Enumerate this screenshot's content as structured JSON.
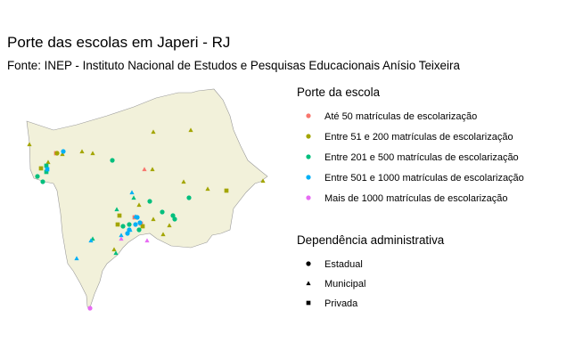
{
  "title": "Porte das escolas em Japeri - RJ",
  "subtitle": "Fonte: INEP - Instituto Nacional de Estudos e Pesquisas Educacionais Anísio Teixeira",
  "colors": {
    "map_fill": "#f2f1da",
    "map_stroke": "#9a9a9a"
  },
  "legend_size": {
    "title": "Porte da escola",
    "items": [
      {
        "key": "ate50",
        "label": "Até 50 matrículas de escolarização",
        "color": "#f8766d"
      },
      {
        "key": "s51_200",
        "label": "Entre 51 e 200 matrículas de escolarização",
        "color": "#a3a500"
      },
      {
        "key": "s201_500",
        "label": "Entre 201 e 500 matrículas de escolarização",
        "color": "#00bf7d"
      },
      {
        "key": "s501_1000",
        "label": "Entre 501 e 1000 matrículas de escolarização",
        "color": "#00b0f6"
      },
      {
        "key": "mais1000",
        "label": "Mais de 1000 matrículas de escolarização",
        "color": "#e76bf3"
      }
    ]
  },
  "legend_type": {
    "title": "Dependência administrativa",
    "items": [
      {
        "key": "estadual",
        "label": "Estadual",
        "shape": "circle"
      },
      {
        "key": "municipal",
        "label": "Municipal",
        "shape": "triangle"
      },
      {
        "key": "privada",
        "label": "Privada",
        "shape": "square"
      }
    ]
  },
  "schools": [
    {
      "porte": "ate50",
      "dep": "privada"
    },
    {
      "porte": "ate50",
      "dep": "municipal"
    },
    {
      "porte": "ate50",
      "dep": "privada"
    },
    {
      "porte": "ate50",
      "dep": "privada"
    },
    {
      "porte": "s51_200",
      "dep": "municipal"
    },
    {
      "porte": "s51_200",
      "dep": "municipal"
    },
    {
      "porte": "s51_200",
      "dep": "municipal"
    },
    {
      "porte": "s51_200",
      "dep": "municipal"
    },
    {
      "porte": "s51_200",
      "dep": "circle"
    },
    {
      "porte": "s51_200",
      "dep": "municipal"
    },
    {
      "porte": "s51_200",
      "dep": "municipal"
    },
    {
      "porte": "s51_200",
      "dep": "municipal"
    },
    {
      "porte": "s51_200",
      "dep": "municipal"
    },
    {
      "porte": "s51_200",
      "dep": "municipal"
    },
    {
      "porte": "s51_200",
      "dep": "municipal"
    },
    {
      "porte": "s51_200",
      "dep": "privada"
    },
    {
      "porte": "s51_200",
      "dep": "municipal"
    },
    {
      "porte": "s51_200",
      "dep": "privada"
    },
    {
      "porte": "s51_200",
      "dep": "municipal"
    },
    {
      "porte": "s51_200",
      "dep": "municipal"
    },
    {
      "porte": "s51_200",
      "dep": "municipal"
    },
    {
      "porte": "s51_200",
      "dep": "privada"
    },
    {
      "porte": "s51_200",
      "dep": "privada"
    },
    {
      "porte": "s51_200",
      "dep": "privada"
    },
    {
      "porte": "s51_200",
      "dep": "municipal"
    },
    {
      "porte": "s51_200",
      "dep": "municipal"
    },
    {
      "porte": "s201_500",
      "dep": "estadual"
    },
    {
      "porte": "s201_500",
      "dep": "estadual"
    },
    {
      "porte": "s201_500",
      "dep": "estadual"
    },
    {
      "porte": "s201_500",
      "dep": "estadual"
    },
    {
      "porte": "s201_500",
      "dep": "municipal"
    },
    {
      "porte": "s201_500",
      "dep": "municipal"
    },
    {
      "porte": "s201_500",
      "dep": "estadual"
    },
    {
      "porte": "s201_500",
      "dep": "estadual"
    },
    {
      "porte": "s201_500",
      "dep": "estadual"
    },
    {
      "porte": "s201_500",
      "dep": "municipal"
    },
    {
      "porte": "s201_500",
      "dep": "municipal"
    },
    {
      "porte": "s201_500",
      "dep": "estadual"
    },
    {
      "porte": "s201_500",
      "dep": "estadual"
    },
    {
      "porte": "s201_500",
      "dep": "estadual"
    },
    {
      "porte": "s201_500",
      "dep": "estadual"
    },
    {
      "porte": "s201_500",
      "dep": "privada"
    },
    {
      "porte": "s201_500",
      "dep": "privada"
    },
    {
      "porte": "s501_1000",
      "dep": "estadual"
    },
    {
      "porte": "s501_1000",
      "dep": "municipal"
    },
    {
      "porte": "s501_1000",
      "dep": "municipal"
    },
    {
      "porte": "s501_1000",
      "dep": "municipal"
    },
    {
      "porte": "s501_1000",
      "dep": "municipal"
    },
    {
      "porte": "s501_1000",
      "dep": "municipal"
    },
    {
      "porte": "s501_1000",
      "dep": "municipal"
    },
    {
      "porte": "s501_1000",
      "dep": "estadual"
    },
    {
      "porte": "s501_1000",
      "dep": "estadual"
    },
    {
      "porte": "s501_1000",
      "dep": "estadual"
    },
    {
      "porte": "s501_1000",
      "dep": "estadual"
    },
    {
      "porte": "s501_1000",
      "dep": "estadual"
    },
    {
      "porte": "s501_1000",
      "dep": "privada"
    },
    {
      "porte": "mais1000",
      "dep": "municipal"
    },
    {
      "porte": "mais1000",
      "dep": "municipal"
    },
    {
      "porte": "mais1000",
      "dep": "estadual"
    }
  ]
}
